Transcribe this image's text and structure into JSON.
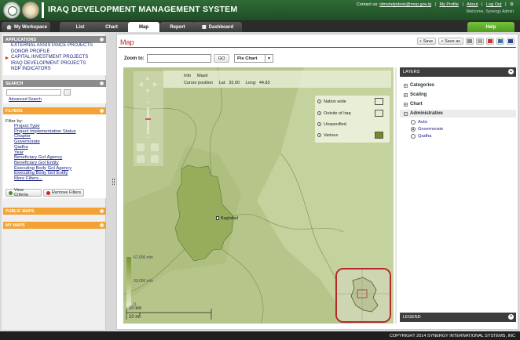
{
  "app": {
    "title": "IRAQ DEVELOPMENT MANAGEMENT SYSTEM"
  },
  "header": {
    "contact_label": "Contact us:",
    "contact_email": "idmshelpdesk@mop.gov.iq",
    "links": [
      "My Profile",
      "About",
      "Log Out"
    ],
    "welcome": "Welcome, Synergy Admin"
  },
  "tabs": {
    "workspace": "My Workspace",
    "list": "List",
    "chart": "Chart",
    "map": "Map",
    "report": "Report",
    "dashboard": "Dashboard",
    "help": "Help"
  },
  "sidebar": {
    "applications": {
      "title": "APPLICATIONS",
      "items": [
        "EXTERNAL ASSISTANCE PROJECTS",
        "DONOR PROFILE",
        "CAPITAL INVESTMENT PROJECTS",
        "IRAQ DEVELOPMENT PROJECTS",
        "NDP INDICATORS"
      ],
      "selected_index": 2
    },
    "search": {
      "title": "SEARCH",
      "advanced": "Advanced Search"
    },
    "filters": {
      "title": "FILTERS",
      "filter_by": "Filter by:",
      "items": [
        "Project Type",
        "Project Implementation Status",
        "Chapter",
        "Governorate",
        "Qadha",
        "Year",
        "Beneficiary GoI Agency",
        "Beneficiary GoI Entity",
        "Executing Body GoI Agency",
        "Executing Body GoI Entity",
        "More Filters..."
      ],
      "view_criteria": "View Criteria",
      "remove_filters": "Remove Filters"
    },
    "public_maps": "PUBLIC MAPS",
    "my_maps": "MY MAPS"
  },
  "main": {
    "title": "Map",
    "toolbar": {
      "save": "Save",
      "save_as": "Save as"
    },
    "zoom_label": "Zoom to:",
    "zoom_go": "GO",
    "chart_type": "Pie Chart"
  },
  "map": {
    "info_label": "Info",
    "info_value": "Wasit",
    "cursor_label": "Cursor position",
    "lat_label": "Lat:",
    "lat": "33.00",
    "long_label": "Long:",
    "long": "44.83",
    "legend": [
      {
        "label": "Nation wide",
        "color": "#e9efcf"
      },
      {
        "label": "Outsite of Iraq",
        "color": "#e4ecc9"
      },
      {
        "label": "Unspecified",
        "color": ""
      },
      {
        "label": "Various",
        "color": "#6f8b24"
      }
    ],
    "city": "Baghdad",
    "scale_top": "67,000 mln",
    "scale_mid": "33,000 mln",
    "scale_bottom": "0",
    "scale_km": "20 km",
    "scale_mi": "20 mi"
  },
  "layers": {
    "title": "LAYERS",
    "groups": [
      "Categories",
      "Scaling",
      "Chart",
      "Administrative"
    ],
    "admin_options": [
      "Auto",
      "Governorate",
      "Qadha"
    ],
    "selected_option": 1,
    "legend_title": "LEGEND"
  },
  "footer": {
    "copyright": "COPYRIGHT 2014 SYNERGY INTERNATIONAL SYSTEMS, INC"
  }
}
